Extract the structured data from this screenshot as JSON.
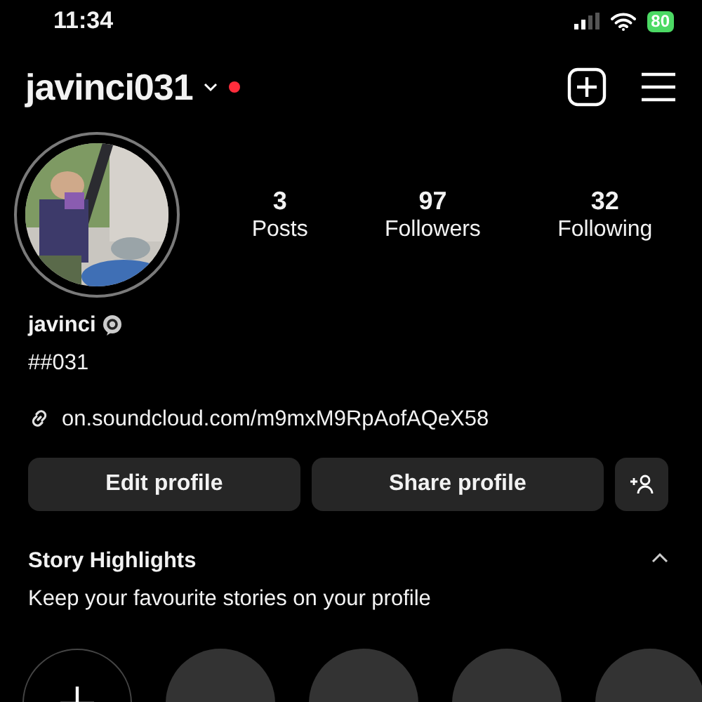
{
  "status_bar": {
    "time": "11:34",
    "battery": "80"
  },
  "header": {
    "username": "javinci031",
    "has_notification": true
  },
  "profile": {
    "posts": {
      "count": "3",
      "label": "Posts"
    },
    "followers": {
      "count": "97",
      "label": "Followers"
    },
    "following": {
      "count": "32",
      "label": "Following"
    },
    "name": "javinci",
    "bio": "##031",
    "link": "on.soundcloud.com/m9mxM9RpAofAQeX58"
  },
  "buttons": [
    "Edit profile",
    "Share profile"
  ],
  "highlights": {
    "title": "Story Highlights",
    "subtitle": "Keep your favourite stories on your profile",
    "expanded": true,
    "items": [
      {
        "kind": "new"
      },
      {
        "kind": "empty"
      },
      {
        "kind": "empty"
      },
      {
        "kind": "empty"
      },
      {
        "kind": "empty"
      }
    ]
  }
}
